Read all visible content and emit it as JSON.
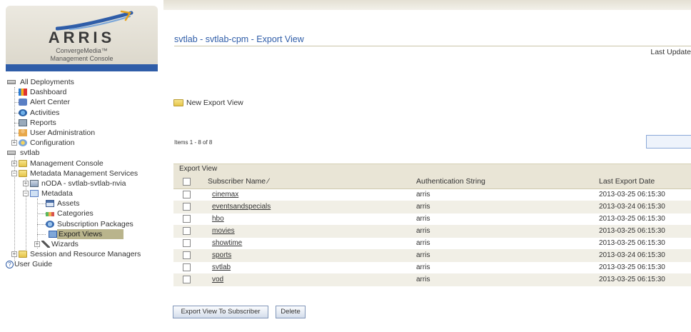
{
  "brand": {
    "logo_text": "ARRIS",
    "product_line1": "ConvergeMedia™",
    "product_line2": "Management Console"
  },
  "nav": {
    "items": [
      {
        "label": "All Deployments",
        "icon": "drive-icon"
      },
      {
        "label": "Dashboard",
        "icon": "dashboard-icon"
      },
      {
        "label": "Alert Center",
        "icon": "alert-icon"
      },
      {
        "label": "Activities",
        "icon": "activities-icon"
      },
      {
        "label": "Reports",
        "icon": "reports-icon"
      },
      {
        "label": "User Administration",
        "icon": "user-icon"
      },
      {
        "label": "Configuration",
        "icon": "configuration-icon"
      },
      {
        "label": "svtlab",
        "icon": "drive-icon"
      },
      {
        "label": "Management Console",
        "icon": "folder-icon"
      },
      {
        "label": "Metadata Management Services",
        "icon": "folder-icon"
      },
      {
        "label": "nODA - svtlab-svtlab-nvia",
        "icon": "server-icon"
      },
      {
        "label": "Metadata",
        "icon": "metadata-icon"
      },
      {
        "label": "Assets",
        "icon": "assets-icon"
      },
      {
        "label": "Categories",
        "icon": "categories-icon"
      },
      {
        "label": "Subscription Packages",
        "icon": "subscription-icon"
      },
      {
        "label": "Export Views",
        "icon": "export-views-icon"
      },
      {
        "label": "Wizards",
        "icon": "wizard-icon"
      },
      {
        "label": "Session and Resource Managers",
        "icon": "folder-icon"
      },
      {
        "label": "User Guide",
        "icon": "help-icon"
      }
    ]
  },
  "main": {
    "title": "svtlab - svtlab-cpm - Export View",
    "last_update": "Last Update",
    "new_export_view": "New Export View",
    "items_count": "Items 1 - 8 of 8",
    "filter_value": "",
    "grid": {
      "caption": "Export View",
      "columns": [
        "Subscriber Name ∕",
        "Authentication String",
        "Last Export Date"
      ],
      "rows": [
        [
          "cinemax",
          "arris",
          "2013-03-25 06:15:30"
        ],
        [
          "eventsandspecials",
          "arris",
          "2013-03-24 06:15:30"
        ],
        [
          "hbo",
          "arris",
          "2013-03-25 06:15:30"
        ],
        [
          "movies",
          "arris",
          "2013-03-25 06:15:30"
        ],
        [
          "showtime",
          "arris",
          "2013-03-25 06:15:30"
        ],
        [
          "sports",
          "arris",
          "2013-03-24 06:15:30"
        ],
        [
          "svtlab",
          "arris",
          "2013-03-25 06:15:30"
        ],
        [
          "vod",
          "arris",
          "2013-03-25 06:15:30"
        ]
      ]
    },
    "buttons": {
      "export_label": "Export View To Subscriber",
      "delete_label": "Delete"
    }
  },
  "colors": {
    "accent": "#2f5da8",
    "header_bg": "#e9e5d6",
    "selected_bg": "#b9b48c"
  }
}
